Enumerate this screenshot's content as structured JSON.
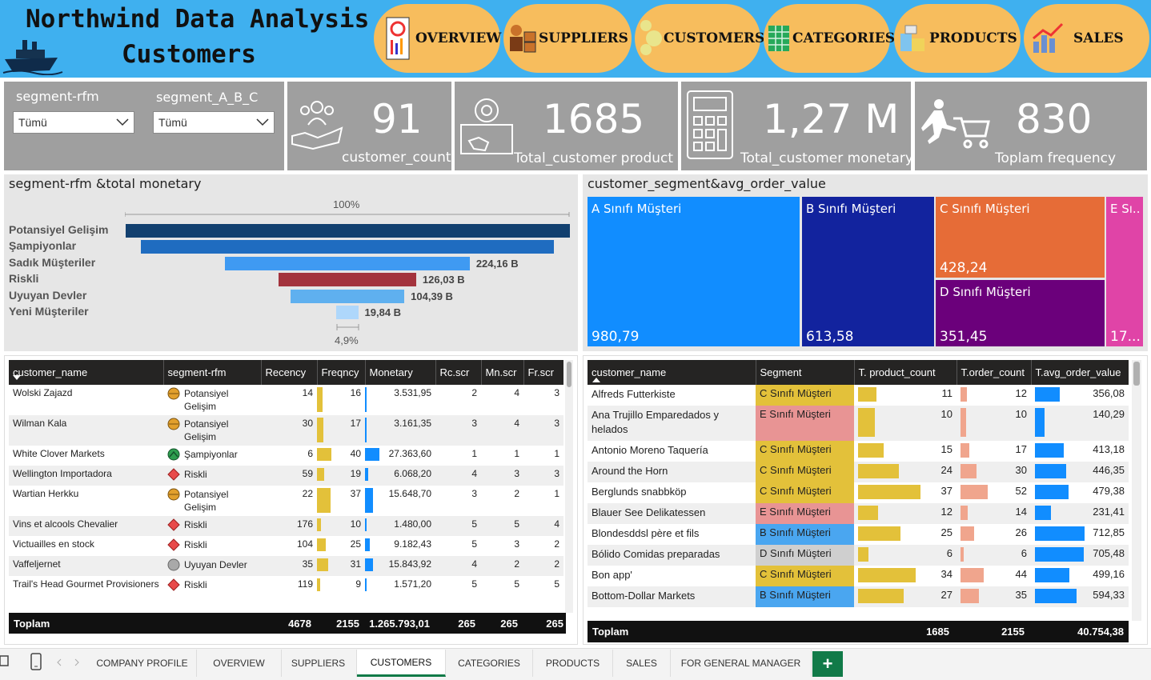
{
  "header": {
    "title_line1": "Northwind Data Analysis",
    "title_line2": "Customers",
    "nav": [
      "OVERVIEW",
      "SUPPLIERS",
      "CUSTOMERS",
      "CATEGORIES",
      "PRODUCTS",
      "SALES"
    ]
  },
  "slicers": {
    "rfm_label": "segment-rfm",
    "rfm_value": "Tümü",
    "abc_label": "segment_A_B_C",
    "abc_value": "Tümü"
  },
  "kpis": [
    {
      "value": "91",
      "label": "customer_count"
    },
    {
      "value": "1685",
      "label": "Total_customer product"
    },
    {
      "value": "1,27 M",
      "label": "Total_customer monetary"
    },
    {
      "value": "830",
      "label": "Toplam frequency"
    }
  ],
  "funnel": {
    "title": "segment-rfm &total monetary",
    "top_pct": "100%",
    "bottom_pct": "4,9%",
    "chart_data": {
      "type": "bar",
      "categories": [
        "Potansiyel Gelişim",
        "Şampiyonlar",
        "Sadık Müşteriler",
        "Riskli",
        "Uyuyan Devler",
        "Yeni Müşteriler"
      ],
      "labels": [
        "",
        "",
        "224,16 B",
        "126,03 B",
        "104,39 B",
        "19,84 B"
      ],
      "values": [
        407,
        378,
        224.16,
        126.03,
        104.39,
        19.84
      ],
      "colors": [
        "#12406f",
        "#1f6cc0",
        "#3f9af2",
        "#a3333d",
        "#5fb0ef",
        "#aed7fb"
      ]
    }
  },
  "treemap": {
    "title": "customer_segment&avg_order_value",
    "chart_data": {
      "type": "heatmap",
      "items": [
        {
          "name": "A Sınıfı Müşteri",
          "value": "980,79",
          "color": "#118dff"
        },
        {
          "name": "B Sınıfı Müşteri",
          "value": "613,58",
          "color": "#12239e"
        },
        {
          "name": "C Sınıfı Müşteri",
          "value": "428,24",
          "color": "#e66c37"
        },
        {
          "name": "D Sınıfı Müşteri",
          "value": "351,45",
          "color": "#6b007b"
        },
        {
          "name": "E Sı...",
          "value": "17...",
          "color": "#e044a7"
        }
      ]
    }
  },
  "table1": {
    "columns": [
      "customer_name",
      "segment-rfm",
      "Recency",
      "Freqncy",
      "Monetary",
      "Rc.scr",
      "Mn.scr",
      "Fr.scr"
    ],
    "rows": [
      {
        "name": "Wolski Zajazd",
        "seg1": "Potansiyel",
        "seg2": "Gelişim",
        "icon": "orange-circle",
        "rec": "14",
        "fr": "16",
        "fr_v": 16,
        "mon": "3.531,95",
        "mon_v": 3531.95,
        "rc": "2",
        "mn": "4",
        "fs": "3"
      },
      {
        "name": "Wilman Kala",
        "seg1": "Potansiyel",
        "seg2": "Gelişim",
        "icon": "orange-circle",
        "rec": "30",
        "fr": "17",
        "fr_v": 17,
        "mon": "3.161,35",
        "mon_v": 3161.35,
        "rc": "3",
        "mn": "4",
        "fs": "3"
      },
      {
        "name": "White Clover Markets",
        "seg1": "Şampiyonlar",
        "seg2": "",
        "icon": "green-up",
        "rec": "6",
        "fr": "40",
        "fr_v": 40,
        "mon": "27.363,60",
        "mon_v": 27363.6,
        "rc": "1",
        "mn": "1",
        "fs": "1"
      },
      {
        "name": "Wellington Importadora",
        "seg1": "Riskli",
        "seg2": "",
        "icon": "red-diamond",
        "rec": "59",
        "fr": "19",
        "fr_v": 19,
        "mon": "6.068,20",
        "mon_v": 6068.2,
        "rc": "4",
        "mn": "3",
        "fs": "3"
      },
      {
        "name": "Wartian Herkku",
        "seg1": "Potansiyel",
        "seg2": "Gelişim",
        "icon": "orange-circle",
        "rec": "22",
        "fr": "37",
        "fr_v": 37,
        "mon": "15.648,70",
        "mon_v": 15648.7,
        "rc": "3",
        "mn": "2",
        "fs": "1"
      },
      {
        "name": "Vins et alcools Chevalier",
        "seg1": "Riskli",
        "seg2": "",
        "icon": "red-diamond",
        "rec": "176",
        "fr": "10",
        "fr_v": 10,
        "mon": "1.480,00",
        "mon_v": 1480,
        "rc": "5",
        "mn": "5",
        "fs": "4"
      },
      {
        "name": "Victuailles en stock",
        "seg1": "Riskli",
        "seg2": "",
        "icon": "red-diamond",
        "rec": "104",
        "fr": "25",
        "fr_v": 25,
        "mon": "9.182,43",
        "mon_v": 9182.43,
        "rc": "5",
        "mn": "3",
        "fs": "2"
      },
      {
        "name": "Vaffeljernet",
        "seg1": "Uyuyan Devler",
        "seg2": "",
        "icon": "gray-circle",
        "rec": "35",
        "fr": "31",
        "fr_v": 31,
        "mon": "15.843,92",
        "mon_v": 15843.92,
        "rc": "4",
        "mn": "2",
        "fs": "2"
      },
      {
        "name": "Trail's Head Gourmet Provisioners",
        "seg1": "Riskli",
        "seg2": "",
        "icon": "red-diamond",
        "rec": "119",
        "fr": "9",
        "fr_v": 9,
        "mon": "1.571,20",
        "mon_v": 1571.2,
        "rc": "5",
        "mn": "5",
        "fs": "5"
      }
    ],
    "total": {
      "label": "Toplam",
      "rec": "4678",
      "fr": "2155",
      "mon": "1.265.793,01",
      "rc": "265",
      "mn": "265",
      "fs": "265"
    }
  },
  "table2": {
    "columns": [
      "customer_name",
      "Segment",
      "T. product_count",
      "T.order_count",
      "T.avg_order_value"
    ],
    "rows": [
      {
        "name": "Alfreds Futterkiste",
        "seg": "C Sınıfı Müşteri",
        "segcolor": "#e3c13a",
        "p": "11",
        "p_v": 11,
        "o": "12",
        "o_v": 12,
        "a": "356,08",
        "a_v": 356.08
      },
      {
        "name": "Ana Trujillo Emparedados y helados",
        "seg": "E Sınıfı Müşteri",
        "segcolor": "#e89494",
        "p": "10",
        "p_v": 10,
        "o": "10",
        "o_v": 10,
        "a": "140,29",
        "a_v": 140.29
      },
      {
        "name": "Antonio Moreno Taquería",
        "seg": "C Sınıfı Müşteri",
        "segcolor": "#e3c13a",
        "p": "15",
        "p_v": 15,
        "o": "17",
        "o_v": 17,
        "a": "413,18",
        "a_v": 413.18
      },
      {
        "name": "Around the Horn",
        "seg": "C Sınıfı Müşteri",
        "segcolor": "#e3c13a",
        "p": "24",
        "p_v": 24,
        "o": "30",
        "o_v": 30,
        "a": "446,35",
        "a_v": 446.35
      },
      {
        "name": "Berglunds snabbköp",
        "seg": "C Sınıfı Müşteri",
        "segcolor": "#e3c13a",
        "p": "37",
        "p_v": 37,
        "o": "52",
        "o_v": 52,
        "a": "479,38",
        "a_v": 479.38
      },
      {
        "name": "Blauer See Delikatessen",
        "seg": "E Sınıfı Müşteri",
        "segcolor": "#e89494",
        "p": "12",
        "p_v": 12,
        "o": "14",
        "o_v": 14,
        "a": "231,41",
        "a_v": 231.41
      },
      {
        "name": "Blondesddsl père et fils",
        "seg": "B Sınıfı Müşteri",
        "segcolor": "#4aa6f0",
        "p": "25",
        "p_v": 25,
        "o": "26",
        "o_v": 26,
        "a": "712,85",
        "a_v": 712.85
      },
      {
        "name": "Bólido Comidas preparadas",
        "seg": "D Sınıfı Müşteri",
        "segcolor": "#cfcfcf",
        "p": "6",
        "p_v": 6,
        "o": "6",
        "o_v": 6,
        "a": "705,48",
        "a_v": 705.48
      },
      {
        "name": "Bon app'",
        "seg": "C Sınıfı Müşteri",
        "segcolor": "#e3c13a",
        "p": "34",
        "p_v": 34,
        "o": "44",
        "o_v": 44,
        "a": "499,16",
        "a_v": 499.16
      },
      {
        "name": "Bottom-Dollar Markets",
        "seg": "B Sınıfı Müşteri",
        "segcolor": "#4aa6f0",
        "p": "27",
        "p_v": 27,
        "o": "35",
        "o_v": 35,
        "a": "594,33",
        "a_v": 594.33
      }
    ],
    "total": {
      "label": "Toplam",
      "p": "1685",
      "o": "2155",
      "a": "40.754,38"
    }
  },
  "tabs": [
    "COMPANY PROFILE",
    "OVERVIEW",
    "SUPPLIERS",
    "CUSTOMERS",
    "CATEGORIES",
    "PRODUCTS",
    "SALES",
    "FOR GENERAL MANAGER"
  ],
  "active_tab": "CUSTOMERS",
  "colors": {
    "header": "#3fb0ef",
    "nav": "#f7bd5d",
    "panel": "#c7c7c7",
    "freq_bar": "#e3c13a",
    "mon_bar": "#118dff",
    "order_bar": "#f0a58d"
  }
}
